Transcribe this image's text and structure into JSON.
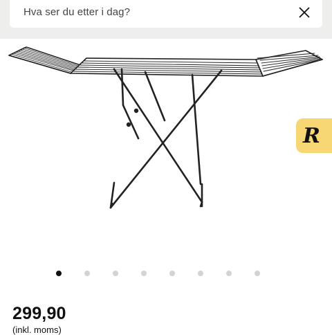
{
  "search": {
    "placeholder": "Hva ser du etter i dag?",
    "close_icon": "close-icon"
  },
  "gallery": {
    "image_description": "drying-rack",
    "total_images": 8,
    "active_index": 0
  },
  "badge": {
    "letter": "R",
    "color": "#f7d774"
  },
  "product": {
    "price": "299,90",
    "price_note": "(inkl. moms)"
  },
  "colors": {
    "background_band": "#eeeeed",
    "accent_badge": "#f7d774"
  }
}
